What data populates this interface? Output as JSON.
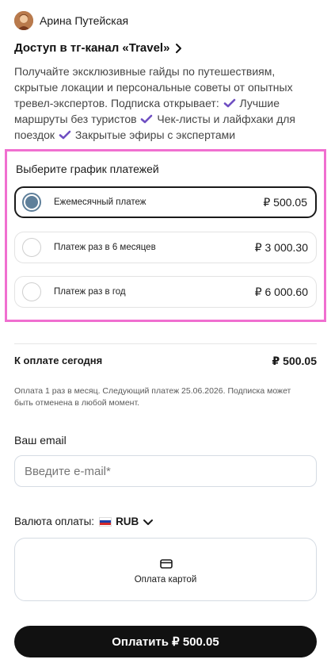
{
  "author": {
    "name": "Арина Путейская"
  },
  "product": {
    "title": "Доступ в тг-канал «Travel»",
    "description": {
      "intro": "Получайте эксклюзивные гайды по путешествиям, скрытые локации и персональные советы от опытных тревел-экспертов. Подписка открывает:",
      "benefits": [
        "Лучшие маршруты без туристов",
        "Чек-листы и лайфхаки для поездок",
        "Закрытые эфиры с экспертами"
      ]
    }
  },
  "payment_schedule": {
    "title": "Выберите график платежей",
    "options": [
      {
        "label": "Ежемесячный платеж",
        "price": "₽ 500.05",
        "selected": true
      },
      {
        "label": "Платеж раз в 6 месяцев",
        "price": "₽ 3 000.30",
        "selected": false
      },
      {
        "label": "Платеж раз в год",
        "price": "₽ 6 000.60",
        "selected": false
      }
    ]
  },
  "summary": {
    "label": "К оплате сегодня",
    "amount": "₽ 500.05",
    "note": "Оплата 1 раз в месяц. Следующий платеж 25.06.2026. Подписка может быть отменена в любой момент."
  },
  "email": {
    "label": "Ваш email",
    "value": "",
    "placeholder": "Введите e-mail*"
  },
  "currency": {
    "label": "Валюта оплаты:",
    "value": "RUB",
    "flag": "russia-flag-icon"
  },
  "payment_method": {
    "label": "Оплата картой",
    "icon": "card-icon"
  },
  "pay_button": {
    "label": "Оплатить ₽ 500.05"
  },
  "colors": {
    "highlight_border": "#f06fd0",
    "check_accent": "#6f4fc2",
    "radio_selected": "#5e7f9a",
    "button_bg": "#111111"
  }
}
